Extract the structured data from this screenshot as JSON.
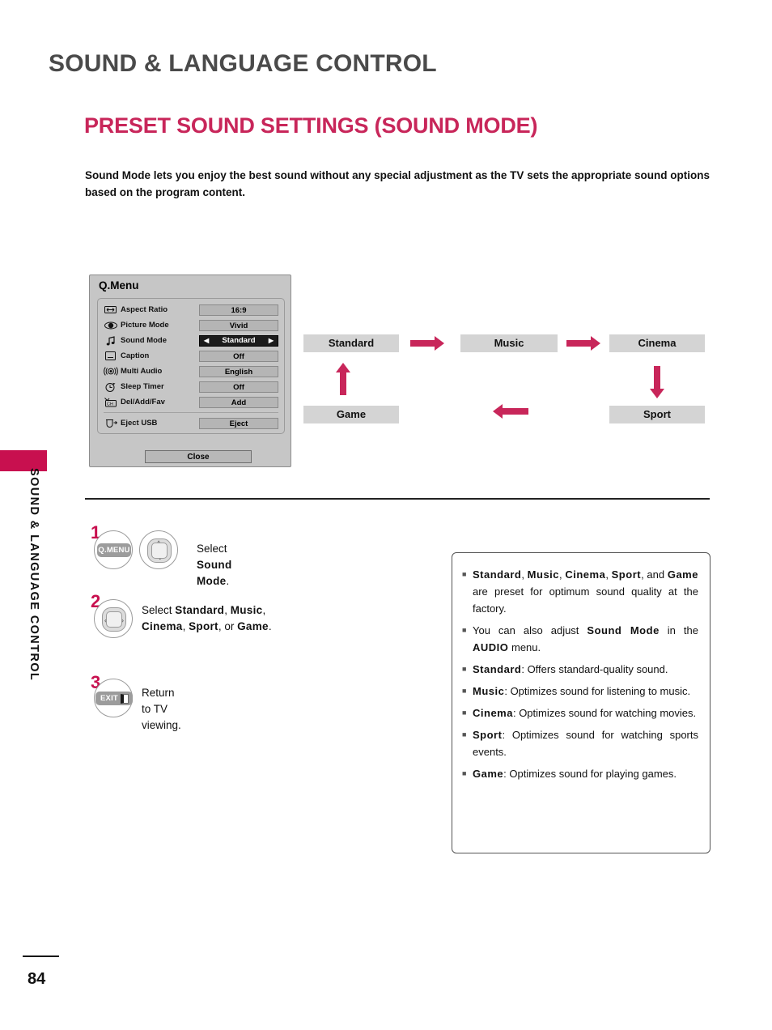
{
  "header": {
    "chapter_title": "SOUND & LANGUAGE CONTROL",
    "section_title": "PRESET SOUND SETTINGS (SOUND MODE)",
    "intro": "Sound Mode lets you enjoy the best sound without any special adjustment as the TV sets the appropriate sound options based on the program content."
  },
  "side_tab": {
    "label": "SOUND & LANGUAGE CONTROL"
  },
  "qmenu": {
    "title": "Q.Menu",
    "rows": [
      {
        "icon": "aspect-ratio-icon",
        "label": "Aspect Ratio",
        "value": "16:9",
        "active": false
      },
      {
        "icon": "picture-mode-icon",
        "label": "Picture Mode",
        "value": "Vivid",
        "active": false
      },
      {
        "icon": "sound-mode-icon",
        "label": "Sound Mode",
        "value": "Standard",
        "active": true
      },
      {
        "icon": "caption-icon",
        "label": "Caption",
        "value": "Off",
        "active": false
      },
      {
        "icon": "multi-audio-icon",
        "label": "Multi Audio",
        "value": "English",
        "active": false
      },
      {
        "icon": "sleep-timer-icon",
        "label": "Sleep Timer",
        "value": "Off",
        "active": false
      },
      {
        "icon": "channel-icon",
        "label": "Del/Add/Fav",
        "value": "Add",
        "active": false
      }
    ],
    "eject_row": {
      "icon": "eject-usb-icon",
      "label": "Eject USB",
      "value": "Eject"
    },
    "close_label": "Close",
    "left_arrow": "◀",
    "right_arrow": "▶"
  },
  "flow": {
    "standard": "Standard",
    "music": "Music",
    "cinema": "Cinema",
    "sport": "Sport",
    "game": "Game"
  },
  "steps": [
    {
      "number": "1",
      "key_label": "Q.MENU",
      "text_prefix": "Select ",
      "text_bold": "Sound Mode",
      "text_suffix": "."
    },
    {
      "number": "2",
      "text_line1_prefix": "Select ",
      "text_line1_b1": "Standard",
      "text_line1_mid": ", ",
      "text_line1_b2": "Music",
      "text_line1_suffix": ",",
      "text_line2_b1": "Cinema",
      "text_line2_mid1": ", ",
      "text_line2_b2": "Sport",
      "text_line2_mid2": ", or ",
      "text_line2_b3": "Game",
      "text_line2_suffix": "."
    },
    {
      "number": "3",
      "key_label": "EXIT",
      "text": "Return to TV viewing."
    }
  ],
  "notes": [
    {
      "parts": [
        {
          "t": "Standard",
          "b": true
        },
        {
          "t": ", ",
          "b": false
        },
        {
          "t": "Music",
          "b": true
        },
        {
          "t": ", ",
          "b": false
        },
        {
          "t": "Cinema",
          "b": true
        },
        {
          "t": ", ",
          "b": false
        },
        {
          "t": "Sport",
          "b": true
        },
        {
          "t": ", and ",
          "b": false
        },
        {
          "t": "Game",
          "b": true
        },
        {
          "t": " are preset for optimum sound quality at the factory.",
          "b": false
        }
      ]
    },
    {
      "parts": [
        {
          "t": "You can also adjust ",
          "b": false
        },
        {
          "t": "Sound Mode",
          "b": true
        },
        {
          "t": " in the ",
          "b": false
        },
        {
          "t": "AUDIO",
          "b": true
        },
        {
          "t": " menu.",
          "b": false
        }
      ]
    },
    {
      "parts": [
        {
          "t": "Standard",
          "b": true
        },
        {
          "t": ": Offers standard-quality sound.",
          "b": false
        }
      ]
    },
    {
      "parts": [
        {
          "t": "Music",
          "b": true
        },
        {
          "t": ": Optimizes sound for listening to music.",
          "b": false
        }
      ]
    },
    {
      "parts": [
        {
          "t": "Cinema",
          "b": true
        },
        {
          "t": ": Optimizes sound for watching movies.",
          "b": false
        }
      ]
    },
    {
      "parts": [
        {
          "t": "Sport",
          "b": true
        },
        {
          "t": ": Optimizes sound for watching sports events.",
          "b": false
        }
      ]
    },
    {
      "parts": [
        {
          "t": "Game",
          "b": true
        },
        {
          "t": ": Optimizes sound for playing games.",
          "b": false
        }
      ]
    }
  ],
  "footer": {
    "page_number": "84"
  },
  "colors": {
    "accent": "#c8265a",
    "accent_dark": "#c8104f",
    "chapter_gray": "#4a4a4a",
    "panel_gray": "#c6c6c6",
    "box_gray": "#d4d4d4"
  }
}
